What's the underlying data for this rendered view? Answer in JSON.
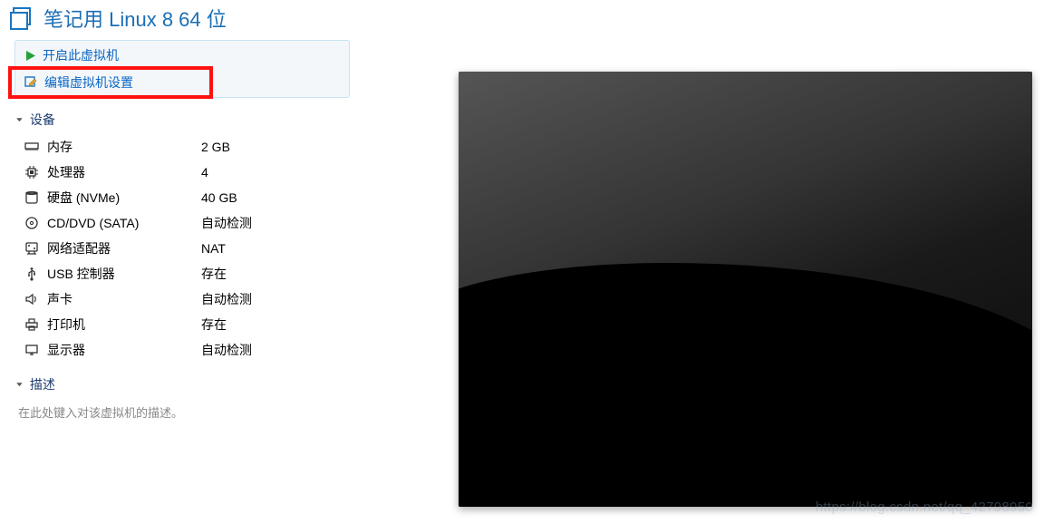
{
  "header": {
    "title": "笔记用 Linux 8 64 位"
  },
  "actions": {
    "power_on": "开启此虚拟机",
    "edit_settings": "编辑虚拟机设置"
  },
  "sections": {
    "devices": "设备",
    "description": "描述"
  },
  "devices": [
    {
      "label": "内存",
      "value": "2 GB",
      "icon": "memory"
    },
    {
      "label": "处理器",
      "value": "4",
      "icon": "cpu"
    },
    {
      "label": "硬盘 (NVMe)",
      "value": "40 GB",
      "icon": "disk"
    },
    {
      "label": "CD/DVD (SATA)",
      "value": "自动检测",
      "icon": "cd"
    },
    {
      "label": "网络适配器",
      "value": "NAT",
      "icon": "network"
    },
    {
      "label": "USB 控制器",
      "value": "存在",
      "icon": "usb"
    },
    {
      "label": "声卡",
      "value": "自动检测",
      "icon": "sound"
    },
    {
      "label": "打印机",
      "value": "存在",
      "icon": "printer"
    },
    {
      "label": "显示器",
      "value": "自动检测",
      "icon": "display"
    }
  ],
  "description": {
    "placeholder": "在此处键入对该虚拟机的描述。"
  },
  "watermark": "https://blog.csdn.net/qq_42798950"
}
